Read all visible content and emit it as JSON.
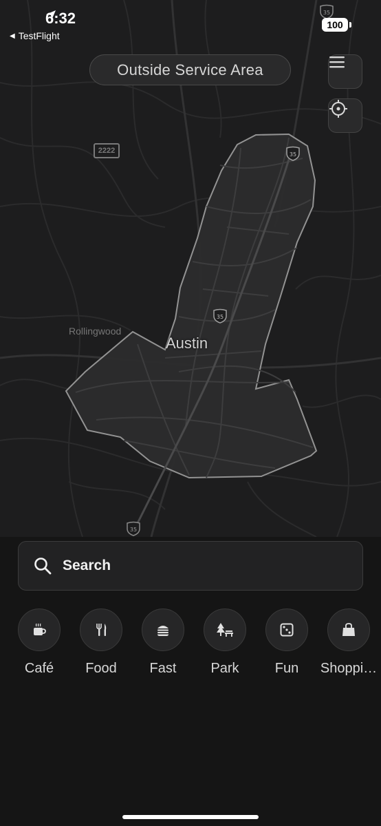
{
  "status_bar": {
    "time": "6:32",
    "back_app": "TestFlight",
    "battery": "100"
  },
  "map": {
    "service_area_label": "Outside Service Area",
    "city_label": "Austin",
    "town_label": "Rollingwood",
    "route_labels": [
      "35",
      "35",
      "35",
      "35",
      "2222"
    ],
    "menu_icon": "hamburger-icon",
    "locate_icon": "crosshair-icon"
  },
  "search": {
    "label": "Search",
    "icon": "search-icon"
  },
  "categories": [
    {
      "label": "Café",
      "icon": "coffee-icon"
    },
    {
      "label": "Food",
      "icon": "fork-knife-icon"
    },
    {
      "label": "Fast",
      "icon": "burger-icon"
    },
    {
      "label": "Park",
      "icon": "tree-bench-icon"
    },
    {
      "label": "Fun",
      "icon": "dice-icon"
    },
    {
      "label": "Shoppi…",
      "icon": "shopping-bag-icon"
    }
  ],
  "colors": {
    "background": "#151515",
    "map_background": "#1d1d1e",
    "service_area_fill": "#2c2c2d",
    "service_area_stroke": "#9a9a9a"
  }
}
